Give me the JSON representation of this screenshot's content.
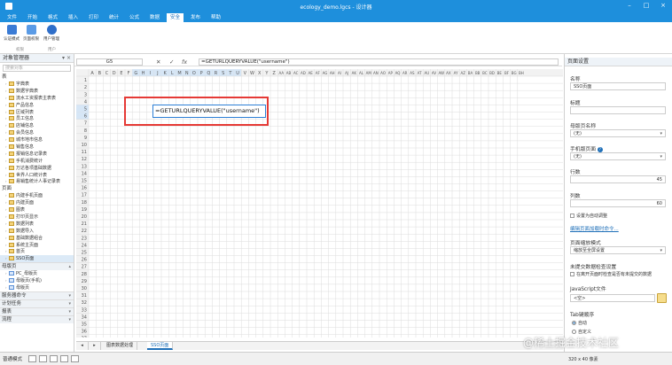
{
  "window": {
    "title": "ecology_demo.lgcs - 设计器"
  },
  "menu": [
    "文件",
    "开始",
    "格式",
    "插入",
    "打印",
    "统计",
    "公式",
    "数据",
    "安全",
    "发布",
    "帮助"
  ],
  "menu_active_index": 8,
  "ribbon": {
    "buttons": [
      "认证模式",
      "页面权限",
      "用户管理"
    ],
    "groups": [
      "权限",
      "用户"
    ]
  },
  "left_panel": {
    "title": "对象管理器",
    "search_placeholder": "搜索对象",
    "section_table": "表",
    "tables": [
      "字典表",
      "数据字典表",
      "流水工资报表主表表",
      "产品信息",
      "区域列表",
      "员工信息",
      "店铺信息",
      "会员信息",
      "城市地市信息",
      "销售信息",
      "报销信息记录表",
      "手机消费统计",
      "万达各项基础数据",
      "世界人口统计表",
      "易销售统计人事记录表"
    ],
    "section_page": "页面",
    "pages": [
      "内建手机页面",
      "内建页面",
      "图表",
      "打印页显示",
      "数据列表",
      "数据导入",
      "基础数据组合",
      "系统主页面",
      "首页",
      "SSO页面"
    ],
    "sections_bottom": [
      "母版页",
      "服务器命令",
      "计划任务",
      "报表",
      "流程"
    ],
    "masters": [
      "PC_母版页",
      "母版页(手机)",
      "母版页"
    ]
  },
  "formula_bar": {
    "name_box": "G5",
    "value": "=GETURLQUERYVALUE(\"username\")"
  },
  "grid": {
    "columns": [
      "A",
      "B",
      "C",
      "D",
      "E",
      "F",
      "G",
      "H",
      "I",
      "J",
      "K",
      "L",
      "M",
      "N",
      "O",
      "P",
      "Q",
      "R",
      "S",
      "T",
      "U",
      "V",
      "W",
      "X",
      "Y",
      "Z",
      "AA",
      "AB",
      "AC",
      "AD",
      "AE",
      "AF",
      "AG",
      "AH",
      "AI",
      "AJ",
      "AK",
      "AL",
      "AM",
      "AN",
      "AO",
      "AP",
      "AQ",
      "AR",
      "AS",
      "AT",
      "AU",
      "AV",
      "AW",
      "AX",
      "AY",
      "AZ",
      "BA",
      "BB",
      "BC",
      "BD",
      "BE",
      "BF",
      "BG",
      "BH"
    ],
    "rows": [
      "1",
      "2",
      "3",
      "4",
      "5",
      "6",
      "7",
      "8",
      "9",
      "10",
      "11",
      "12",
      "13",
      "14",
      "15",
      "16",
      "17",
      "18",
      "19",
      "20",
      "21",
      "22",
      "23",
      "24",
      "25",
      "26",
      "27",
      "28",
      "29",
      "30",
      "31",
      "32",
      "33",
      "34",
      "35",
      "36",
      "37",
      "38"
    ],
    "active_cell_text": "=GETURLQUERYVALUE(\"username\")"
  },
  "sheet_tabs": [
    "图表数据处理",
    "SSO页面"
  ],
  "sheet_tab_active": 1,
  "right_panel": {
    "title": "页面设置",
    "name_label": "名称",
    "name_value": "SSO页面",
    "caption_label": "标题",
    "caption_value": "",
    "master_label": "母版页名称",
    "master_value": "(无)",
    "mobile_label": "手机版页面",
    "mobile_value": "(无)",
    "rows_label": "行数",
    "rows_value": "45",
    "cols_label": "列数",
    "cols_value": "60",
    "auto_adjust": "设置为自动调整",
    "link_text": "编辑页面加载时命令...",
    "scale_label": "页面缩放模式",
    "scale_value": "缩放至全屏设置",
    "unsaved_label": "未提交数据检查设置",
    "unsaved_check": "在离开页面时检查是否有未提交的数据",
    "js_label": "JavaScript文件",
    "js_value": "<空>",
    "tab_label": "Tab键顺序",
    "tab_auto": "自动",
    "tab_custom": "自定义"
  },
  "status": {
    "mode": "普通模式",
    "size": "320 x 40 像素"
  },
  "watermark": "@稀土掘金技术社区"
}
